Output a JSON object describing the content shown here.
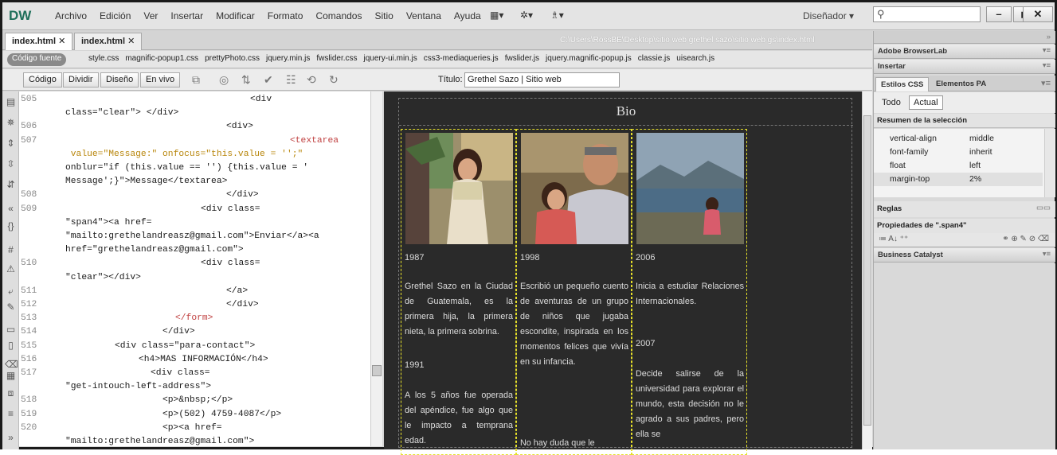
{
  "app": {
    "logo": "DW",
    "menus": [
      "Archivo",
      "Edición",
      "Ver",
      "Insertar",
      "Modificar",
      "Formato",
      "Comandos",
      "Sitio",
      "Ventana",
      "Ayuda"
    ],
    "workspace": "Diseñador",
    "search_placeholder": "",
    "window_buttons": {
      "min": "–",
      "max": "🗗",
      "close": "✕"
    }
  },
  "doc_tabs": [
    "index.html",
    "index.html"
  ],
  "doc_path": "C:\\Users\\RossBE\\Desktop\\sitio web grethel sazo\\sitio web gs\\index.html",
  "related": {
    "source_button": "Código fuente",
    "files": [
      "style.css",
      "magnific-popup1.css",
      "prettyPhoto.css",
      "jquery.min.js",
      "fwslider.css",
      "jquery-ui.min.js",
      "css3-mediaqueries.js",
      "fwslider.js",
      "jquery.magnific-popup.js",
      "classie.js",
      "uisearch.js"
    ]
  },
  "toolbar": {
    "views": [
      "Código",
      "Dividir",
      "Diseño",
      "En vivo"
    ],
    "title_label": "Título:",
    "title_value": "Grethel Sazo | Sitio web"
  },
  "code_lines": [
    {
      "n": "505",
      "t": "<div"
    },
    {
      "n": "",
      "t": "class=\"clear\"> </div>"
    },
    {
      "n": "506",
      "t": "<div>"
    },
    {
      "n": "507",
      "t": "<textarea"
    },
    {
      "n": "",
      "t": " value=\"Message:\" onfocus=\"this.value = '';\""
    },
    {
      "n": "",
      "t": "onblur=\"if (this.value == '') {this.value = '"
    },
    {
      "n": "",
      "t": "Message';}\">Message</textarea>"
    },
    {
      "n": "508",
      "t": "</div>"
    },
    {
      "n": "509",
      "t": "<div class="
    },
    {
      "n": "",
      "t": "\"span4\"><a href="
    },
    {
      "n": "",
      "t": "\"mailto:grethelandreasz@gmail.com\">Enviar</a><a"
    },
    {
      "n": "",
      "t": "href=\"grethelandreasz@gmail.com\">"
    },
    {
      "n": "510",
      "t": "<div class="
    },
    {
      "n": "",
      "t": "\"clear\"></div>"
    },
    {
      "n": "511",
      "t": "</a>"
    },
    {
      "n": "512",
      "t": "</div>"
    },
    {
      "n": "513",
      "t": "</form>"
    },
    {
      "n": "514",
      "t": "</div>"
    },
    {
      "n": "515",
      "t": "<div class=\"para-contact\">"
    },
    {
      "n": "516",
      "t": "<h4>MAS INFORMACIÓN</h4>"
    },
    {
      "n": "517",
      "t": "<div class="
    },
    {
      "n": "",
      "t": "\"get-intouch-left-address\">"
    },
    {
      "n": "518",
      "t": "<p>&nbsp;</p>"
    },
    {
      "n": "519",
      "t": "<p>(502) 4759-4087</p>"
    },
    {
      "n": "520",
      "t": "<p><a href="
    },
    {
      "n": "",
      "t": "\"mailto:grethelandreasz@gmail.com\">"
    }
  ],
  "design": {
    "heading": "Bio",
    "columns": [
      {
        "year1": "1987",
        "text1": "Grethel Sazo en la Ciudad de Guatemala, es la primera hija, la primera nieta, la primera sobrina.",
        "year2": "1991",
        "text2": "A los 5 años fue operada del apéndice, fue algo que le impacto a temprana edad."
      },
      {
        "year1": "1998",
        "text1": "Escribió un pequeño cuento de aventuras de un grupo de niños que jugaba escondite, inspirada en los momentos felices que vivía en su infancia.",
        "year2": "",
        "text2": "No hay duda que le"
      },
      {
        "year1": "2006",
        "text1": "Inicia a estudiar Relaciones Internacionales.",
        "year2": "2007",
        "text2": "Decide salirse de la universidad para explorar el mundo, esta decisión no le agrado a sus padres, pero ella se"
      }
    ]
  },
  "right_panel": {
    "browserlab": "Adobe BrowserLab",
    "insertar": "Insertar",
    "tabs": [
      "Estilos CSS",
      "Elementos PA"
    ],
    "modes": [
      "Todo",
      "Actual"
    ],
    "summary": "Resumen de la selección",
    "props": [
      {
        "k": "vertical-align",
        "v": "middle"
      },
      {
        "k": "font-family",
        "v": "inherit"
      },
      {
        "k": "float",
        "v": "left"
      },
      {
        "k": "margin-top",
        "v": "2%"
      }
    ],
    "reglas": "Reglas",
    "props_of": "Propiedades de \".span4\"",
    "business": "Business Catalyst"
  }
}
